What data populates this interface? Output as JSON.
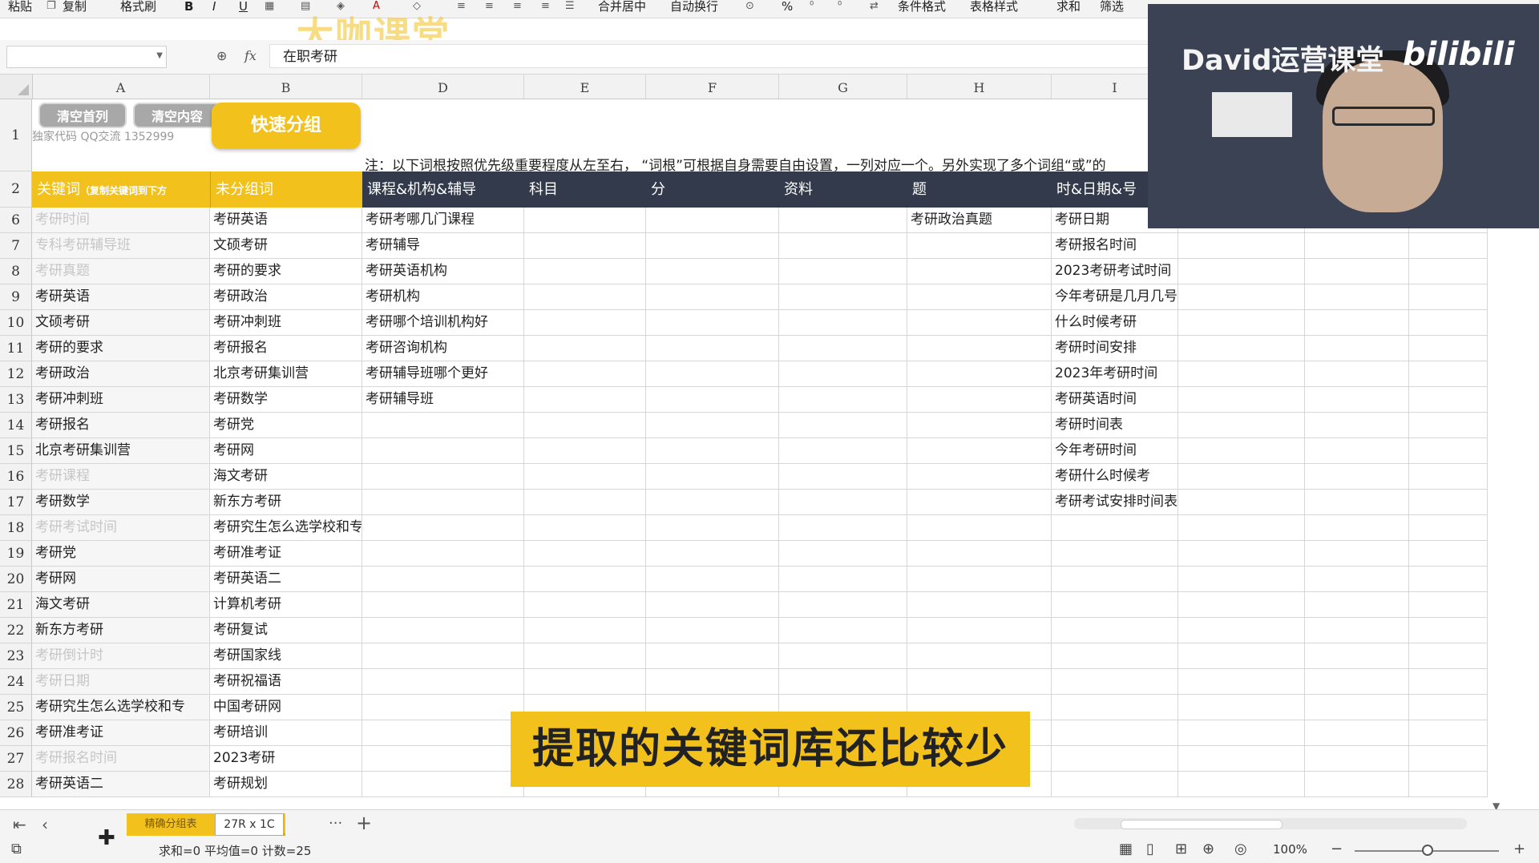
{
  "toolbar": {
    "paste": "粘贴",
    "copy": "复制",
    "format_painter": "格式刷",
    "bold": "B",
    "italic": "I",
    "underline": "U",
    "merge": "合并居中",
    "wrap": "自动换行",
    "percent": "%",
    "cond_format": "条件格式",
    "table_style": "表格样式",
    "sum": "求和",
    "filter": "筛选"
  },
  "watermark": "大咖课堂",
  "formula_bar": {
    "name_box": "",
    "fx": "fx",
    "value": "在职考研"
  },
  "columns": [
    "A",
    "B",
    "D",
    "E",
    "F",
    "G",
    "H",
    "I"
  ],
  "row1": {
    "btn_clear_first_col": "清空首列",
    "btn_clear_content": "清空内容",
    "btn_quick_group": "快速分组",
    "qq_text": "独家代码 QQ交流 1352999",
    "note": "注：以下词根按照优先级重要程度从左至右， “词根”可根据自身需要自由设置，一列对应一个。另外实现了多个词组“或”的"
  },
  "row2": {
    "a": "关键词",
    "a_small": "（复制关键词到下方",
    "b": "未分组词",
    "d": "课程&机构&辅导",
    "e": "科目",
    "f": "分",
    "g": "资料",
    "h": "题",
    "i": "时&日期&号"
  },
  "rows": [
    {
      "n": "6",
      "a": "考研时间",
      "ag": true,
      "b": "考研英语",
      "d": "考研考哪几门课程",
      "h": "考研政治真题",
      "i": "考研日期"
    },
    {
      "n": "7",
      "a": "专科考研辅导班",
      "ag": true,
      "b": "文硕考研",
      "d": "考研辅导",
      "h": "",
      "i": "考研报名时间"
    },
    {
      "n": "8",
      "a": "考研真题",
      "ag": true,
      "b": "考研的要求",
      "d": "考研英语机构",
      "h": "",
      "i": "2023考研考试时间"
    },
    {
      "n": "9",
      "a": "考研英语",
      "ag": false,
      "b": "考研政治",
      "d": "考研机构",
      "h": "",
      "i": "今年考研是几月几号"
    },
    {
      "n": "10",
      "a": "文硕考研",
      "ag": false,
      "b": "考研冲刺班",
      "d": "考研哪个培训机构好",
      "h": "",
      "i": "什么时候考研"
    },
    {
      "n": "11",
      "a": "考研的要求",
      "ag": false,
      "b": "考研报名",
      "d": "考研咨询机构",
      "h": "",
      "i": "考研时间安排"
    },
    {
      "n": "12",
      "a": "考研政治",
      "ag": false,
      "b": "北京考研集训营",
      "d": "考研辅导班哪个更好",
      "h": "",
      "i": "2023年考研时间"
    },
    {
      "n": "13",
      "a": "考研冲刺班",
      "ag": false,
      "b": "考研数学",
      "d": "考研辅导班",
      "h": "",
      "i": "考研英语时间"
    },
    {
      "n": "14",
      "a": "考研报名",
      "ag": false,
      "b": "考研党",
      "d": "",
      "h": "",
      "i": "考研时间表"
    },
    {
      "n": "15",
      "a": "北京考研集训营",
      "ag": false,
      "b": "考研网",
      "d": "",
      "h": "",
      "i": "今年考研时间"
    },
    {
      "n": "16",
      "a": "考研课程",
      "ag": true,
      "b": "海文考研",
      "d": "",
      "h": "",
      "i": "考研什么时候考"
    },
    {
      "n": "17",
      "a": "考研数学",
      "ag": false,
      "b": "新东方考研",
      "d": "",
      "h": "",
      "i": "考研考试安排时间表"
    },
    {
      "n": "18",
      "a": "考研考试时间",
      "ag": true,
      "b": "考研究生怎么选学校和专",
      "d": "",
      "h": "",
      "i": ""
    },
    {
      "n": "19",
      "a": "考研党",
      "ag": false,
      "b": "考研准考证",
      "d": "",
      "h": "",
      "i": ""
    },
    {
      "n": "20",
      "a": "考研网",
      "ag": false,
      "b": "考研英语二",
      "d": "",
      "h": "",
      "i": ""
    },
    {
      "n": "21",
      "a": "海文考研",
      "ag": false,
      "b": "计算机考研",
      "d": "",
      "h": "",
      "i": ""
    },
    {
      "n": "22",
      "a": "新东方考研",
      "ag": false,
      "b": "考研复试",
      "d": "",
      "h": "",
      "i": ""
    },
    {
      "n": "23",
      "a": "考研倒计时",
      "ag": true,
      "b": "考研国家线",
      "d": "",
      "h": "",
      "i": ""
    },
    {
      "n": "24",
      "a": "考研日期",
      "ag": true,
      "b": "考研祝福语",
      "d": "",
      "h": "",
      "i": ""
    },
    {
      "n": "25",
      "a": "考研究生怎么选学校和专",
      "ag": false,
      "b": "中国考研网",
      "d": "",
      "h": "",
      "i": ""
    },
    {
      "n": "26",
      "a": "考研准考证",
      "ag": false,
      "b": "考研培训",
      "d": "",
      "h": "",
      "i": ""
    },
    {
      "n": "27",
      "a": "考研报名时间",
      "ag": true,
      "b": "2023考研",
      "d": "",
      "h": "",
      "i": ""
    },
    {
      "n": "28",
      "a": "考研英语二",
      "ag": false,
      "b": "考研规划",
      "d": "",
      "h": "",
      "i": ""
    }
  ],
  "sheet_tabs": {
    "active": "精确分组表",
    "selected_suffix": "组表",
    "tooltip": "27R x 1C",
    "more": "···",
    "add": "+"
  },
  "status": {
    "summary": "求和=0  平均值=0  计数=25",
    "zoom": "100%"
  },
  "webcam": {
    "title": "David运营课堂",
    "brand": "bilibili"
  },
  "caption": "提取的关键词库还比较少",
  "colors": {
    "accent_yellow": "#f3c11b",
    "header_dark": "#323a4b",
    "grey_text": "#c6c6c6"
  }
}
